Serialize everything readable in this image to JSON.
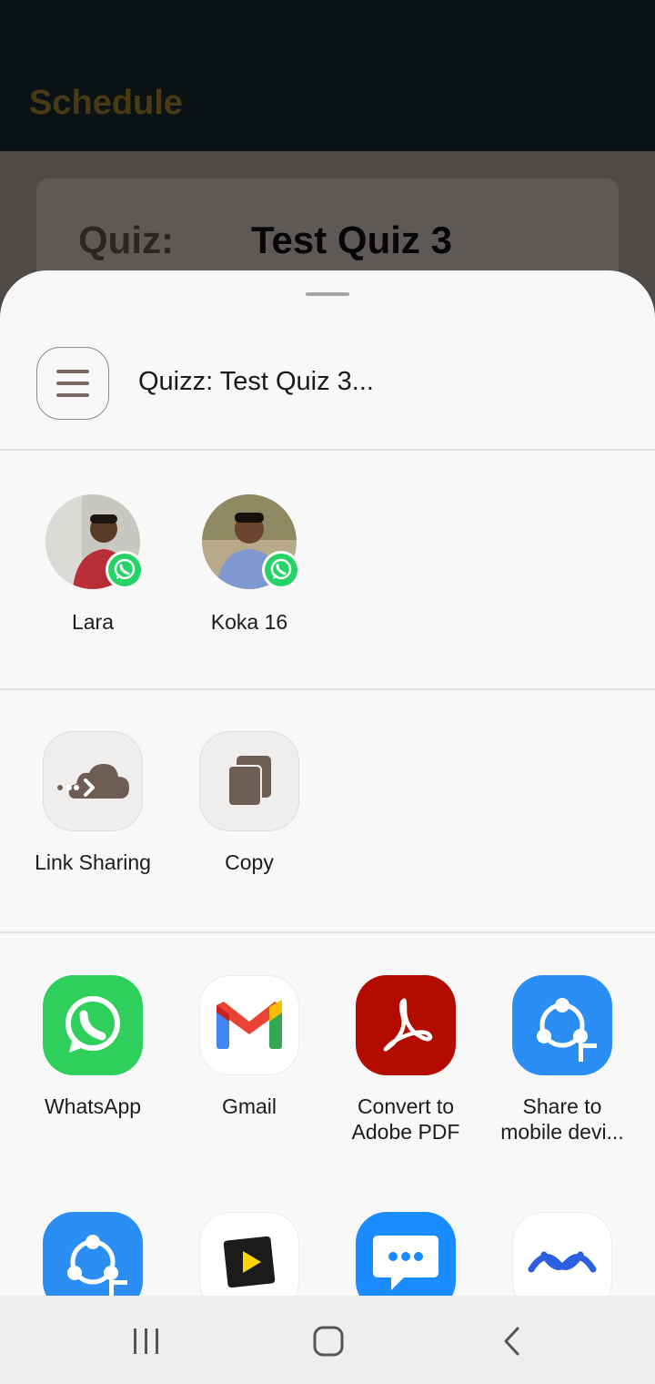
{
  "background_app": {
    "title": "Schedule",
    "quiz_label": "Quiz:",
    "quiz_value": "Test Quiz 3"
  },
  "share_sheet": {
    "preview_text": "Quizz: Test Quiz 3...",
    "contacts": [
      {
        "name": "Lara",
        "badge": "whatsapp-icon"
      },
      {
        "name": "Koka 16",
        "badge": "whatsapp-icon"
      }
    ],
    "actions": [
      {
        "label": "Link Sharing",
        "icon": "link-sharing-icon"
      },
      {
        "label": "Copy",
        "icon": "copy-icon"
      }
    ],
    "apps_row1": [
      {
        "label": "WhatsApp",
        "icon": "whatsapp-icon"
      },
      {
        "label": "Gmail",
        "icon": "gmail-icon"
      },
      {
        "label": "Convert to Adobe PDF",
        "line1": "Convert to",
        "line2": "Adobe PDF",
        "icon": "adobe-pdf-icon"
      },
      {
        "label": "Share to mobile devi...",
        "line1": "Share to",
        "line2": "mobile devi...",
        "icon": "shareit-icon"
      }
    ],
    "apps_row2": [
      {
        "icon": "shareit-icon"
      },
      {
        "icon": "video-player-icon"
      },
      {
        "icon": "messages-icon"
      },
      {
        "icon": "smart-switch-icon"
      }
    ]
  },
  "colors": {
    "whatsapp": "#25d366",
    "adobe": "#b30b00",
    "shareit": "#1e90ff",
    "messages": "#1a8cff"
  },
  "navbar": {
    "buttons": [
      "recent-apps",
      "home",
      "back"
    ]
  }
}
